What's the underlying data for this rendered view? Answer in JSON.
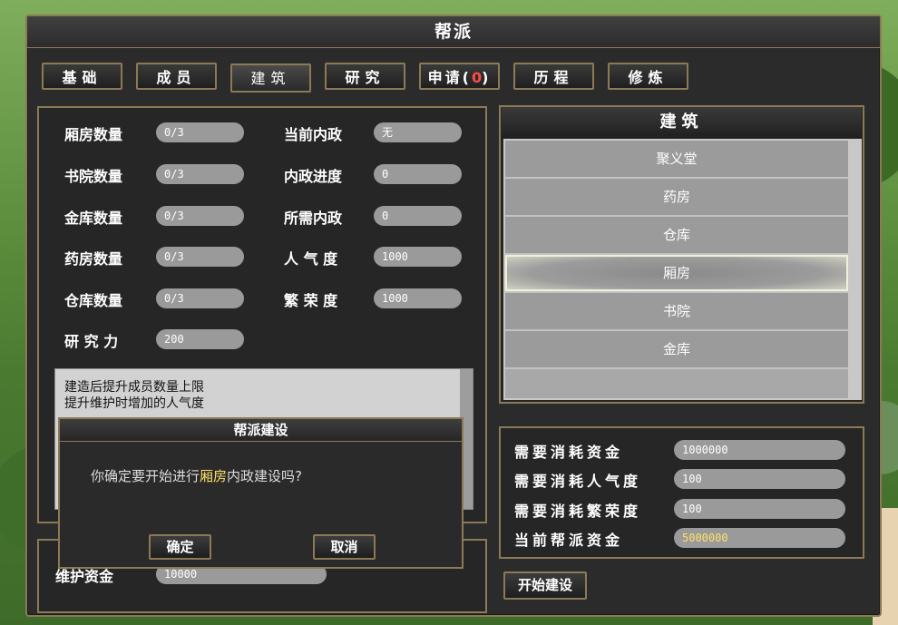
{
  "window": {
    "title": "帮派"
  },
  "tabs": [
    {
      "label": "基础"
    },
    {
      "label": "成员"
    },
    {
      "label": "建筑"
    },
    {
      "label": "研究"
    },
    {
      "label": "申请(",
      "count": "0",
      "suffix": ")"
    },
    {
      "label": "历程"
    },
    {
      "label": "修炼"
    }
  ],
  "stats_left": [
    {
      "label": "厢房数量",
      "value": "0/3"
    },
    {
      "label": "书院数量",
      "value": "0/3"
    },
    {
      "label": "金库数量",
      "value": "0/3"
    },
    {
      "label": "药房数量",
      "value": "0/3"
    },
    {
      "label": "仓库数量",
      "value": "0/3"
    },
    {
      "label": "研 究 力",
      "value": "200"
    }
  ],
  "stats_right": [
    {
      "label": "当前内政",
      "value": "无"
    },
    {
      "label": "内政进度",
      "value": "0"
    },
    {
      "label": "所需内政",
      "value": "0"
    },
    {
      "label": "人 气 度",
      "value": "1000"
    },
    {
      "label": "繁 荣 度",
      "value": "1000"
    }
  ],
  "description": {
    "line1": "建造后提升成员数量上限",
    "line2": "提升维护时增加的人气度"
  },
  "maintenance": {
    "label": "维护资金",
    "value": "10000"
  },
  "building_list": {
    "header": "建筑",
    "items": [
      "聚义堂",
      "药房",
      "仓库",
      "厢房",
      "书院",
      "金库"
    ],
    "selected": "厢房"
  },
  "costs": [
    {
      "label": "需要消耗资金",
      "value": "1000000"
    },
    {
      "label": "需要消耗人气度",
      "value": "100"
    },
    {
      "label": "需要消耗繁荣度",
      "value": "100"
    },
    {
      "label": "当前帮派资金",
      "value": "5000000"
    }
  ],
  "start_button": {
    "label": "开始建设"
  },
  "dialog": {
    "title": "帮派建设",
    "message_prefix": "你确定要开始进行",
    "message_highlight": "厢房",
    "message_suffix": "内政建设吗?",
    "confirm_label": "确定",
    "cancel_label": "取消"
  },
  "colors": {
    "frame_border": "#8c7a56",
    "highlight": "#ffe066",
    "count_red": "#ff4a4a"
  }
}
